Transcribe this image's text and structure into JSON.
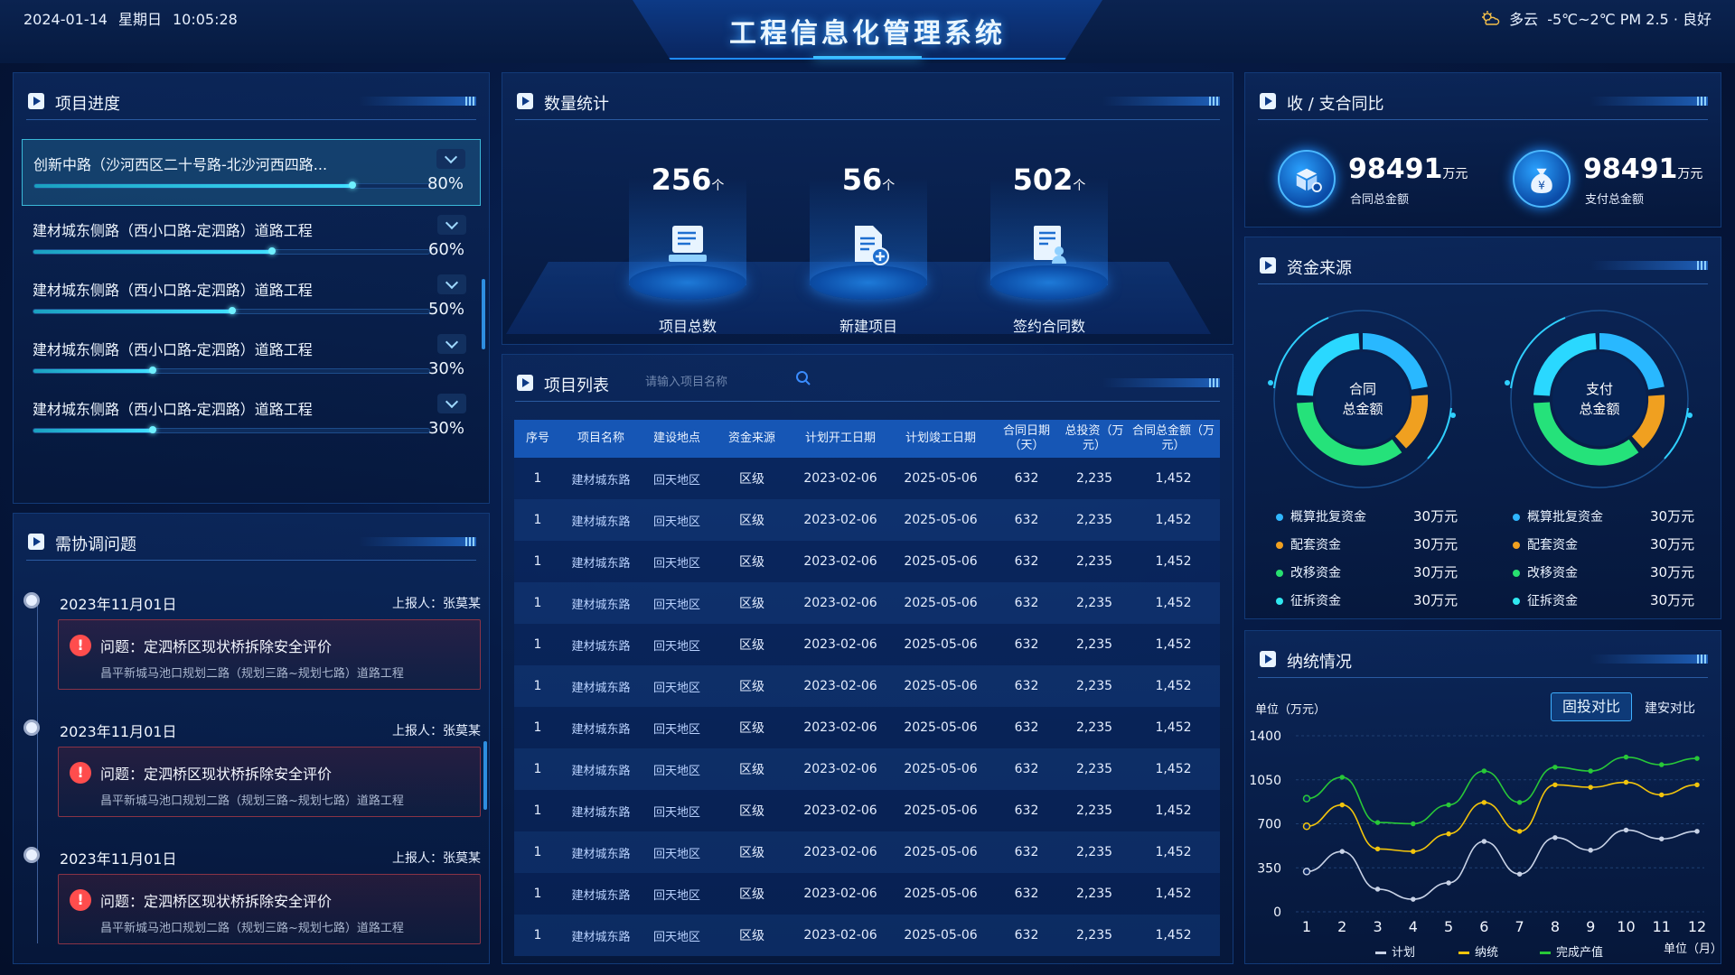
{
  "header": {
    "date": "2024-01-14",
    "weekday": "星期日",
    "time": "10:05:28",
    "title": "工程信息化管理系统",
    "weather": "多云",
    "temp": "-5℃~2℃ PM 2.5 · 良好"
  },
  "progress": {
    "title": "项目进度",
    "items": [
      {
        "name": "创新中路（沙河西区二十号路-北沙河西四路...",
        "pct": "80%",
        "value": 0.8
      },
      {
        "name": "建材城东侧路（西小口路-定泗路）道路工程",
        "pct": "60%",
        "value": 0.6
      },
      {
        "name": "建材城东侧路（西小口路-定泗路）道路工程",
        "pct": "50%",
        "value": 0.5
      },
      {
        "name": "建材城东侧路（西小口路-定泗路）道路工程",
        "pct": "30%",
        "value": 0.3
      },
      {
        "name": "建材城东侧路（西小口路-定泗路）道路工程",
        "pct": "30%",
        "value": 0.3
      }
    ]
  },
  "issues": {
    "title": "需协调问题",
    "items": [
      {
        "date": "2023年11月01日",
        "reporter": "上报人：张莫某",
        "question": "问题：定泗桥区现状桥拆除安全评价",
        "detail": "昌平新城马池口规划二路（规划三路~规划七路）道路工程"
      },
      {
        "date": "2023年11月01日",
        "reporter": "上报人：张莫某",
        "question": "问题：定泗桥区现状桥拆除安全评价",
        "detail": "昌平新城马池口规划二路（规划三路~规划七路）道路工程"
      },
      {
        "date": "2023年11月01日",
        "reporter": "上报人：张莫某",
        "question": "问题：定泗桥区现状桥拆除安全评价",
        "detail": "昌平新城马池口规划二路（规划三路~规划七路）道路工程"
      }
    ]
  },
  "stats": {
    "title": "数量统计",
    "items": [
      {
        "value": "256",
        "unit": "个",
        "label": "项目总数"
      },
      {
        "value": "56",
        "unit": "个",
        "label": "新建项目"
      },
      {
        "value": "502",
        "unit": "个",
        "label": "签约合同数"
      }
    ]
  },
  "projects": {
    "title": "项目列表",
    "search_placeholder": "请输入项目名称",
    "headers": [
      "序号",
      "项目名称",
      "建设地点",
      "资金来源",
      "计划开工日期",
      "计划竣工日期",
      "合同日期（天）",
      "总投资（万元）",
      "合同总金额（万元）"
    ],
    "rows": [
      [
        "1",
        "建材城东路",
        "回天地区",
        "区级",
        "2023-02-06",
        "2025-05-06",
        "632",
        "2,235",
        "1,452"
      ],
      [
        "1",
        "建材城东路",
        "回天地区",
        "区级",
        "2023-02-06",
        "2025-05-06",
        "632",
        "2,235",
        "1,452"
      ],
      [
        "1",
        "建材城东路",
        "回天地区",
        "区级",
        "2023-02-06",
        "2025-05-06",
        "632",
        "2,235",
        "1,452"
      ],
      [
        "1",
        "建材城东路",
        "回天地区",
        "区级",
        "2023-02-06",
        "2025-05-06",
        "632",
        "2,235",
        "1,452"
      ],
      [
        "1",
        "建材城东路",
        "回天地区",
        "区级",
        "2023-02-06",
        "2025-05-06",
        "632",
        "2,235",
        "1,452"
      ],
      [
        "1",
        "建材城东路",
        "回天地区",
        "区级",
        "2023-02-06",
        "2025-05-06",
        "632",
        "2,235",
        "1,452"
      ],
      [
        "1",
        "建材城东路",
        "回天地区",
        "区级",
        "2023-02-06",
        "2025-05-06",
        "632",
        "2,235",
        "1,452"
      ],
      [
        "1",
        "建材城东路",
        "回天地区",
        "区级",
        "2023-02-06",
        "2025-05-06",
        "632",
        "2,235",
        "1,452"
      ],
      [
        "1",
        "建材城东路",
        "回天地区",
        "区级",
        "2023-02-06",
        "2025-05-06",
        "632",
        "2,235",
        "1,452"
      ],
      [
        "1",
        "建材城东路",
        "回天地区",
        "区级",
        "2023-02-06",
        "2025-05-06",
        "632",
        "2,235",
        "1,452"
      ],
      [
        "1",
        "建材城东路",
        "回天地区",
        "区级",
        "2023-02-06",
        "2025-05-06",
        "632",
        "2,235",
        "1,452"
      ],
      [
        "1",
        "建材城东路",
        "回天地区",
        "区级",
        "2023-02-06",
        "2025-05-06",
        "632",
        "2,235",
        "1,452"
      ]
    ]
  },
  "income": {
    "title": "收 / 支合同比",
    "items": [
      {
        "value": "98491",
        "unit": "万元",
        "label": "合同总金额",
        "icon": "box-gear-icon"
      },
      {
        "value": "98491",
        "unit": "万元",
        "label": "支付总金额",
        "icon": "money-bag-icon"
      }
    ]
  },
  "funds": {
    "title": "资金来源",
    "donuts": [
      {
        "label1": "合同",
        "label2": "总金额"
      },
      {
        "label1": "支付",
        "label2": "总金额"
      }
    ],
    "legend": [
      {
        "name": "概算批复资金",
        "value": "30万元",
        "color": "#2fb6ff"
      },
      {
        "name": "配套资金",
        "value": "30万元",
        "color": "#f0a020"
      },
      {
        "name": "改移资金",
        "value": "30万元",
        "color": "#28e070"
      },
      {
        "name": "征拆资金",
        "value": "30万元",
        "color": "#30e8f0"
      }
    ]
  },
  "tax": {
    "title": "纳统情况",
    "unit": "单位（万元）",
    "btn_active": "固投对比",
    "btn_other": "建安对比",
    "xunit": "单位（月）",
    "yticks": [
      "1400",
      "1050",
      "700",
      "350",
      "0"
    ]
  },
  "chart_data": {
    "type": "line",
    "categories": [
      "1",
      "2",
      "3",
      "4",
      "5",
      "6",
      "7",
      "8",
      "9",
      "10",
      "11",
      "12"
    ],
    "ylim": [
      0,
      1400
    ],
    "series": [
      {
        "name": "计划",
        "color": "#c8d2e6",
        "values": [
          320,
          480,
          180,
          100,
          230,
          560,
          300,
          590,
          490,
          650,
          580,
          640
        ]
      },
      {
        "name": "纳统",
        "color": "#f2c40c",
        "values": [
          680,
          850,
          500,
          480,
          620,
          870,
          640,
          1010,
          990,
          1030,
          930,
          1010
        ]
      },
      {
        "name": "完成产值",
        "color": "#28c838",
        "values": [
          900,
          1070,
          710,
          700,
          850,
          1120,
          870,
          1150,
          1120,
          1230,
          1170,
          1220
        ]
      }
    ]
  }
}
